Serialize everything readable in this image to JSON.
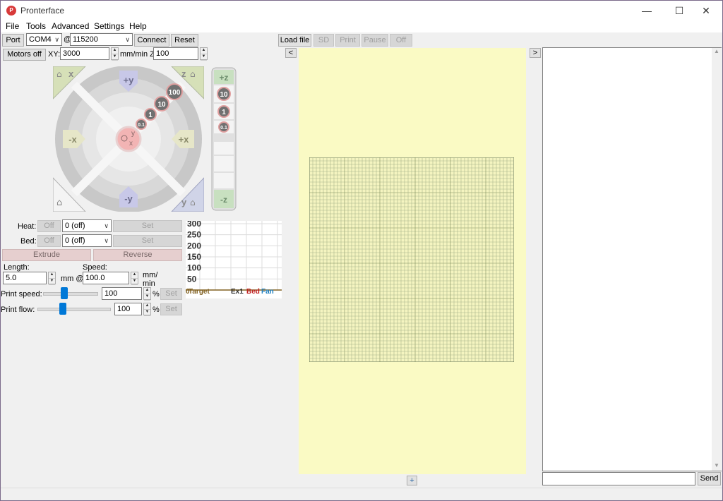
{
  "window": {
    "title": "Pronterface",
    "icon_text": "P",
    "minimize": "—",
    "maximize": "☐",
    "close": "✕"
  },
  "menu": [
    "File",
    "Tools",
    "Advanced",
    "Settings",
    "Help"
  ],
  "connection": {
    "port_label": "Port",
    "port_value": "COM4",
    "at": "@",
    "baud_value": "115200",
    "connect_label": "Connect",
    "reset_label": "Reset"
  },
  "motors": {
    "motors_off_label": "Motors off",
    "xy_label": "XY:",
    "xy_value": "3000",
    "units_label": "mm/min Z:",
    "z_value": "100"
  },
  "jog": {
    "home_x": "x",
    "home_z": "z",
    "home_y": "y",
    "plus_y": "+y",
    "minus_y": "-y",
    "plus_x": "+x",
    "minus_x": "-x",
    "steps": [
      "100",
      "10",
      "1",
      "0.1"
    ],
    "center_y": "y",
    "center_x": "x"
  },
  "zjog": {
    "plus_z": "+z",
    "minus_z": "-z",
    "steps": [
      "10",
      "1",
      "0.1"
    ]
  },
  "heater": {
    "heat_label": "Heat:",
    "heat_off": "Off",
    "heat_value": "0 (off)",
    "heat_set": "Set",
    "bed_label": "Bed:",
    "bed_off": "Off",
    "bed_value": "0 (off)",
    "bed_set": "Set"
  },
  "extrude": {
    "extrude_label": "Extrude",
    "reverse_label": "Reverse",
    "length_label": "Length:",
    "length_value": "5.0",
    "mm_at": "mm @",
    "speed_label": "Speed:",
    "speed_value": "100.0",
    "mm_label": "mm/",
    "min_label": "min"
  },
  "print_controls": {
    "speed_label": "Print speed:",
    "speed_value": "100",
    "speed_pct": "%",
    "speed_set": "Set",
    "speed_slider_pct": 0.4,
    "flow_label": "Print flow:",
    "flow_value": "100",
    "flow_pct": "%",
    "flow_set": "Set",
    "flow_slider_pct": 0.35
  },
  "chart_data": {
    "type": "line",
    "y_ticks": [
      "300",
      "250",
      "200",
      "150",
      "100",
      "50"
    ],
    "ylim": [
      0,
      300
    ],
    "legend": [
      {
        "name": "Target",
        "color": "#806020"
      },
      {
        "name": "Ex1",
        "color": "#303030"
      },
      {
        "name": "Bed",
        "color": "#c02020"
      },
      {
        "name": "Fan",
        "color": "#2080c0"
      }
    ],
    "prefix_label": "0"
  },
  "toolbar": {
    "load_file": "Load file",
    "sd": "SD",
    "print": "Print",
    "pause": "Pause",
    "off": "Off",
    "collapse_left": "<",
    "collapse_right": ">",
    "plus": "+"
  },
  "console": {
    "input_value": "",
    "send_label": "Send",
    "scroll_up": "▲",
    "scroll_down": "▼"
  },
  "colors": {
    "preview_bg": "#fafac4",
    "grid": "#8a9a6a"
  }
}
